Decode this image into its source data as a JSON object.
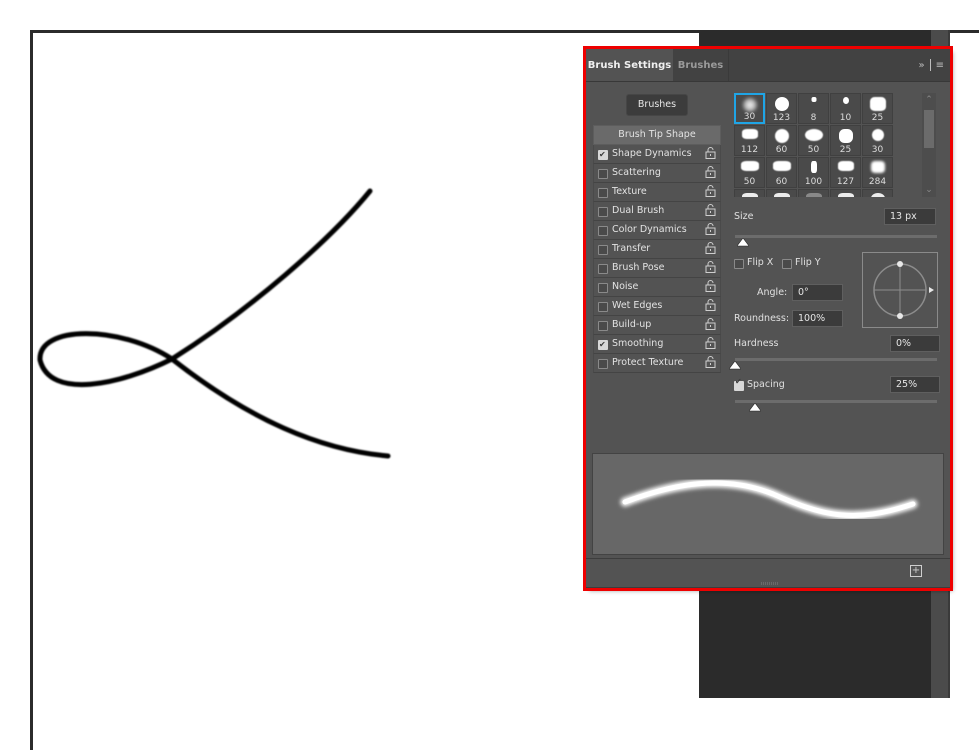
{
  "panel": {
    "tabs": [
      {
        "label": "Brush Settings",
        "active": true
      },
      {
        "label": "Brushes",
        "active": false
      }
    ],
    "collapse_icon": "double-chevron-right-icon",
    "menu_icon": "hamburger-menu-icon",
    "brushes_button_label": "Brushes",
    "options": [
      {
        "label": "Brush Tip Shape",
        "header": true
      },
      {
        "label": "Shape Dynamics",
        "checked": true,
        "lock": true
      },
      {
        "label": "Scattering",
        "checked": false,
        "lock": true
      },
      {
        "label": "Texture",
        "checked": false,
        "lock": true
      },
      {
        "label": "Dual Brush",
        "checked": false,
        "lock": true
      },
      {
        "label": "Color Dynamics",
        "checked": false,
        "lock": true
      },
      {
        "label": "Transfer",
        "checked": false,
        "lock": true
      },
      {
        "label": "Brush Pose",
        "checked": false,
        "lock": true
      },
      {
        "label": "Noise",
        "checked": false,
        "lock": true
      },
      {
        "label": "Wet Edges",
        "checked": false,
        "lock": true
      },
      {
        "label": "Build-up",
        "checked": false,
        "lock": true
      },
      {
        "label": "Smoothing",
        "checked": true,
        "lock": true
      },
      {
        "label": "Protect Texture",
        "checked": false,
        "lock": true
      }
    ],
    "presets": [
      {
        "size": "30",
        "selected": true
      },
      {
        "size": "123"
      },
      {
        "size": "8"
      },
      {
        "size": "10"
      },
      {
        "size": "25"
      },
      {
        "size": "112"
      },
      {
        "size": "60"
      },
      {
        "size": "50"
      },
      {
        "size": "25"
      },
      {
        "size": "30"
      },
      {
        "size": "50"
      },
      {
        "size": "60"
      },
      {
        "size": "100"
      },
      {
        "size": "127"
      },
      {
        "size": "284"
      }
    ],
    "size": {
      "label": "Size",
      "value": "13 px",
      "slider_fraction": 0.04
    },
    "flip_x": {
      "label": "Flip X",
      "checked": false
    },
    "flip_y": {
      "label": "Flip Y",
      "checked": false
    },
    "angle": {
      "label": "Angle:",
      "value": "0°"
    },
    "roundness": {
      "label": "Roundness:",
      "value": "100%"
    },
    "hardness": {
      "label": "Hardness",
      "value": "0%",
      "slider_fraction": 0.0
    },
    "spacing": {
      "label": "Spacing",
      "value": "25%",
      "checked": true,
      "slider_fraction": 0.1
    },
    "new_brush_icon": "new-brush-plus-icon"
  },
  "colors": {
    "panel_bg": "#535353",
    "selected_preset": "#1fa5e6",
    "highlight_outline": "#ee0000",
    "canvas_bg": "#ffffff",
    "stroke": "#000000"
  }
}
